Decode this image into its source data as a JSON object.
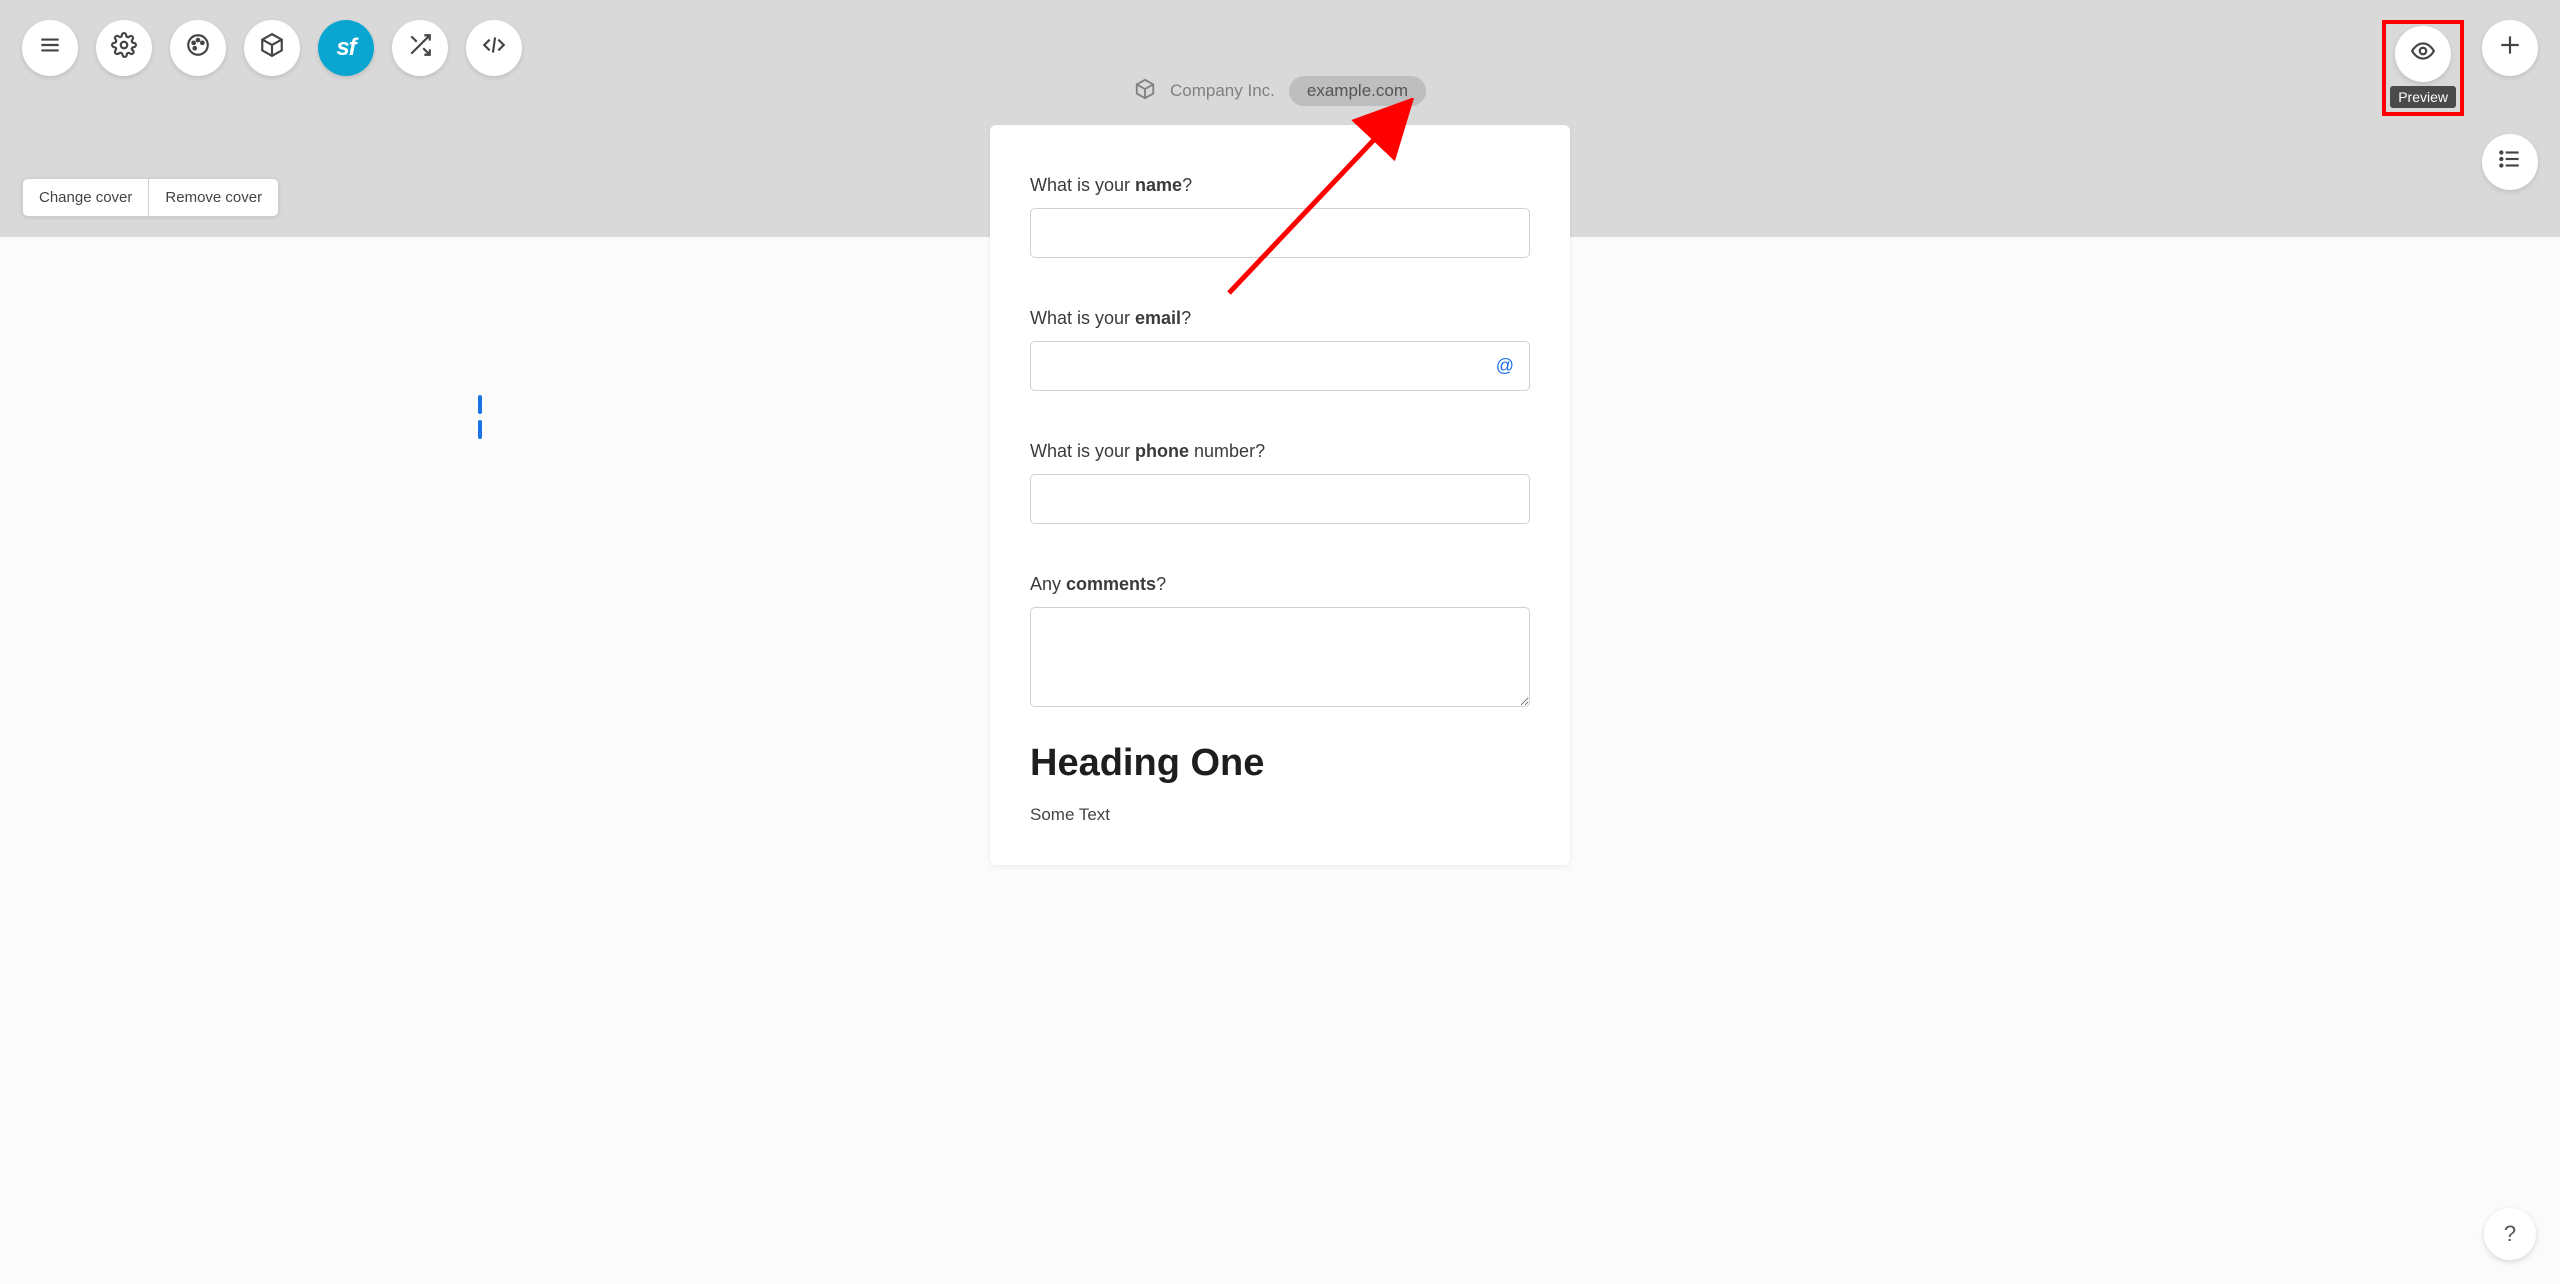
{
  "toolbar": {
    "sf_label": "sf",
    "preview_tooltip": "Preview"
  },
  "site": {
    "company": "Company Inc.",
    "domain": "example.com"
  },
  "cover_actions": {
    "change": "Change cover",
    "remove": "Remove cover"
  },
  "form": {
    "fields": [
      {
        "label_pre": "What is your ",
        "label_bold": "name",
        "label_post": "?",
        "type": "text"
      },
      {
        "label_pre": "What is your ",
        "label_bold": "email",
        "label_post": "?",
        "type": "email"
      },
      {
        "label_pre": "What is your ",
        "label_bold": "phone",
        "label_post": " number?",
        "type": "text"
      },
      {
        "label_pre": "Any ",
        "label_bold": "comments",
        "label_post": "?",
        "type": "textarea"
      }
    ],
    "heading": "Heading One",
    "body_text": "Some Text",
    "email_icon": "@"
  },
  "help_label": "?"
}
